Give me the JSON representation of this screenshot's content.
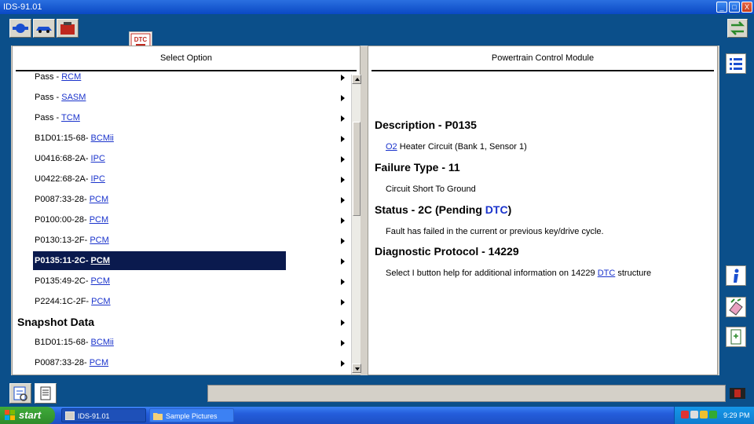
{
  "window": {
    "title": "IDS-91.01",
    "controls": [
      "_",
      "□",
      "X"
    ]
  },
  "toolbar": {
    "dtc_tab_label": "DTC"
  },
  "left_panel": {
    "header": "Select Option",
    "rows": [
      {
        "prefix": "Pass - ",
        "link": "RCM"
      },
      {
        "prefix": "Pass - ",
        "link": "SASM"
      },
      {
        "prefix": "Pass - ",
        "link": "TCM"
      },
      {
        "prefix": "B1D01:15-68- ",
        "link": "BCMii"
      },
      {
        "prefix": "U0416:68-2A- ",
        "link": "IPC"
      },
      {
        "prefix": "U0422:68-2A- ",
        "link": "IPC"
      },
      {
        "prefix": "P0087:33-28- ",
        "link": "PCM"
      },
      {
        "prefix": "P0100:00-28- ",
        "link": "PCM"
      },
      {
        "prefix": "P0130:13-2F- ",
        "link": "PCM"
      },
      {
        "prefix": "P0135:11-2C- ",
        "link": "PCM",
        "selected": true
      },
      {
        "prefix": "P0135:49-2C- ",
        "link": "PCM"
      },
      {
        "prefix": "P2244:1C-2F- ",
        "link": "PCM"
      },
      {
        "section": "Snapshot Data"
      },
      {
        "prefix": "B1D01:15-68- ",
        "link": "BCMii"
      },
      {
        "prefix": "P0087:33-28- ",
        "link": "PCM"
      }
    ]
  },
  "right_panel": {
    "header": "Powertrain Control Module",
    "description_heading": "Description - P0135",
    "description_link": "O2",
    "description_text": " Heater Circuit (Bank 1, Sensor 1)",
    "failure_heading": "Failure Type - 11",
    "failure_text": "Circuit Short To Ground",
    "status_heading_prefix": "Status - 2C (Pending ",
    "status_heading_link": "DTC",
    "status_heading_suffix": ")",
    "status_text": "Fault has failed in the current or previous key/drive cycle.",
    "protocol_heading": "Diagnostic Protocol - 14229",
    "protocol_text_prefix": "Select I button help for additional information on 14229 ",
    "protocol_text_link": "DTC",
    "protocol_text_suffix": " structure"
  },
  "taskbar": {
    "start_label": "start",
    "tasks": [
      "IDS-91.01",
      "Sample Pictures"
    ],
    "clock": "9:29 PM"
  },
  "colors": {
    "accent": "#0b4f8a",
    "selection": "#0a1a4e",
    "link": "#1a33cc"
  }
}
